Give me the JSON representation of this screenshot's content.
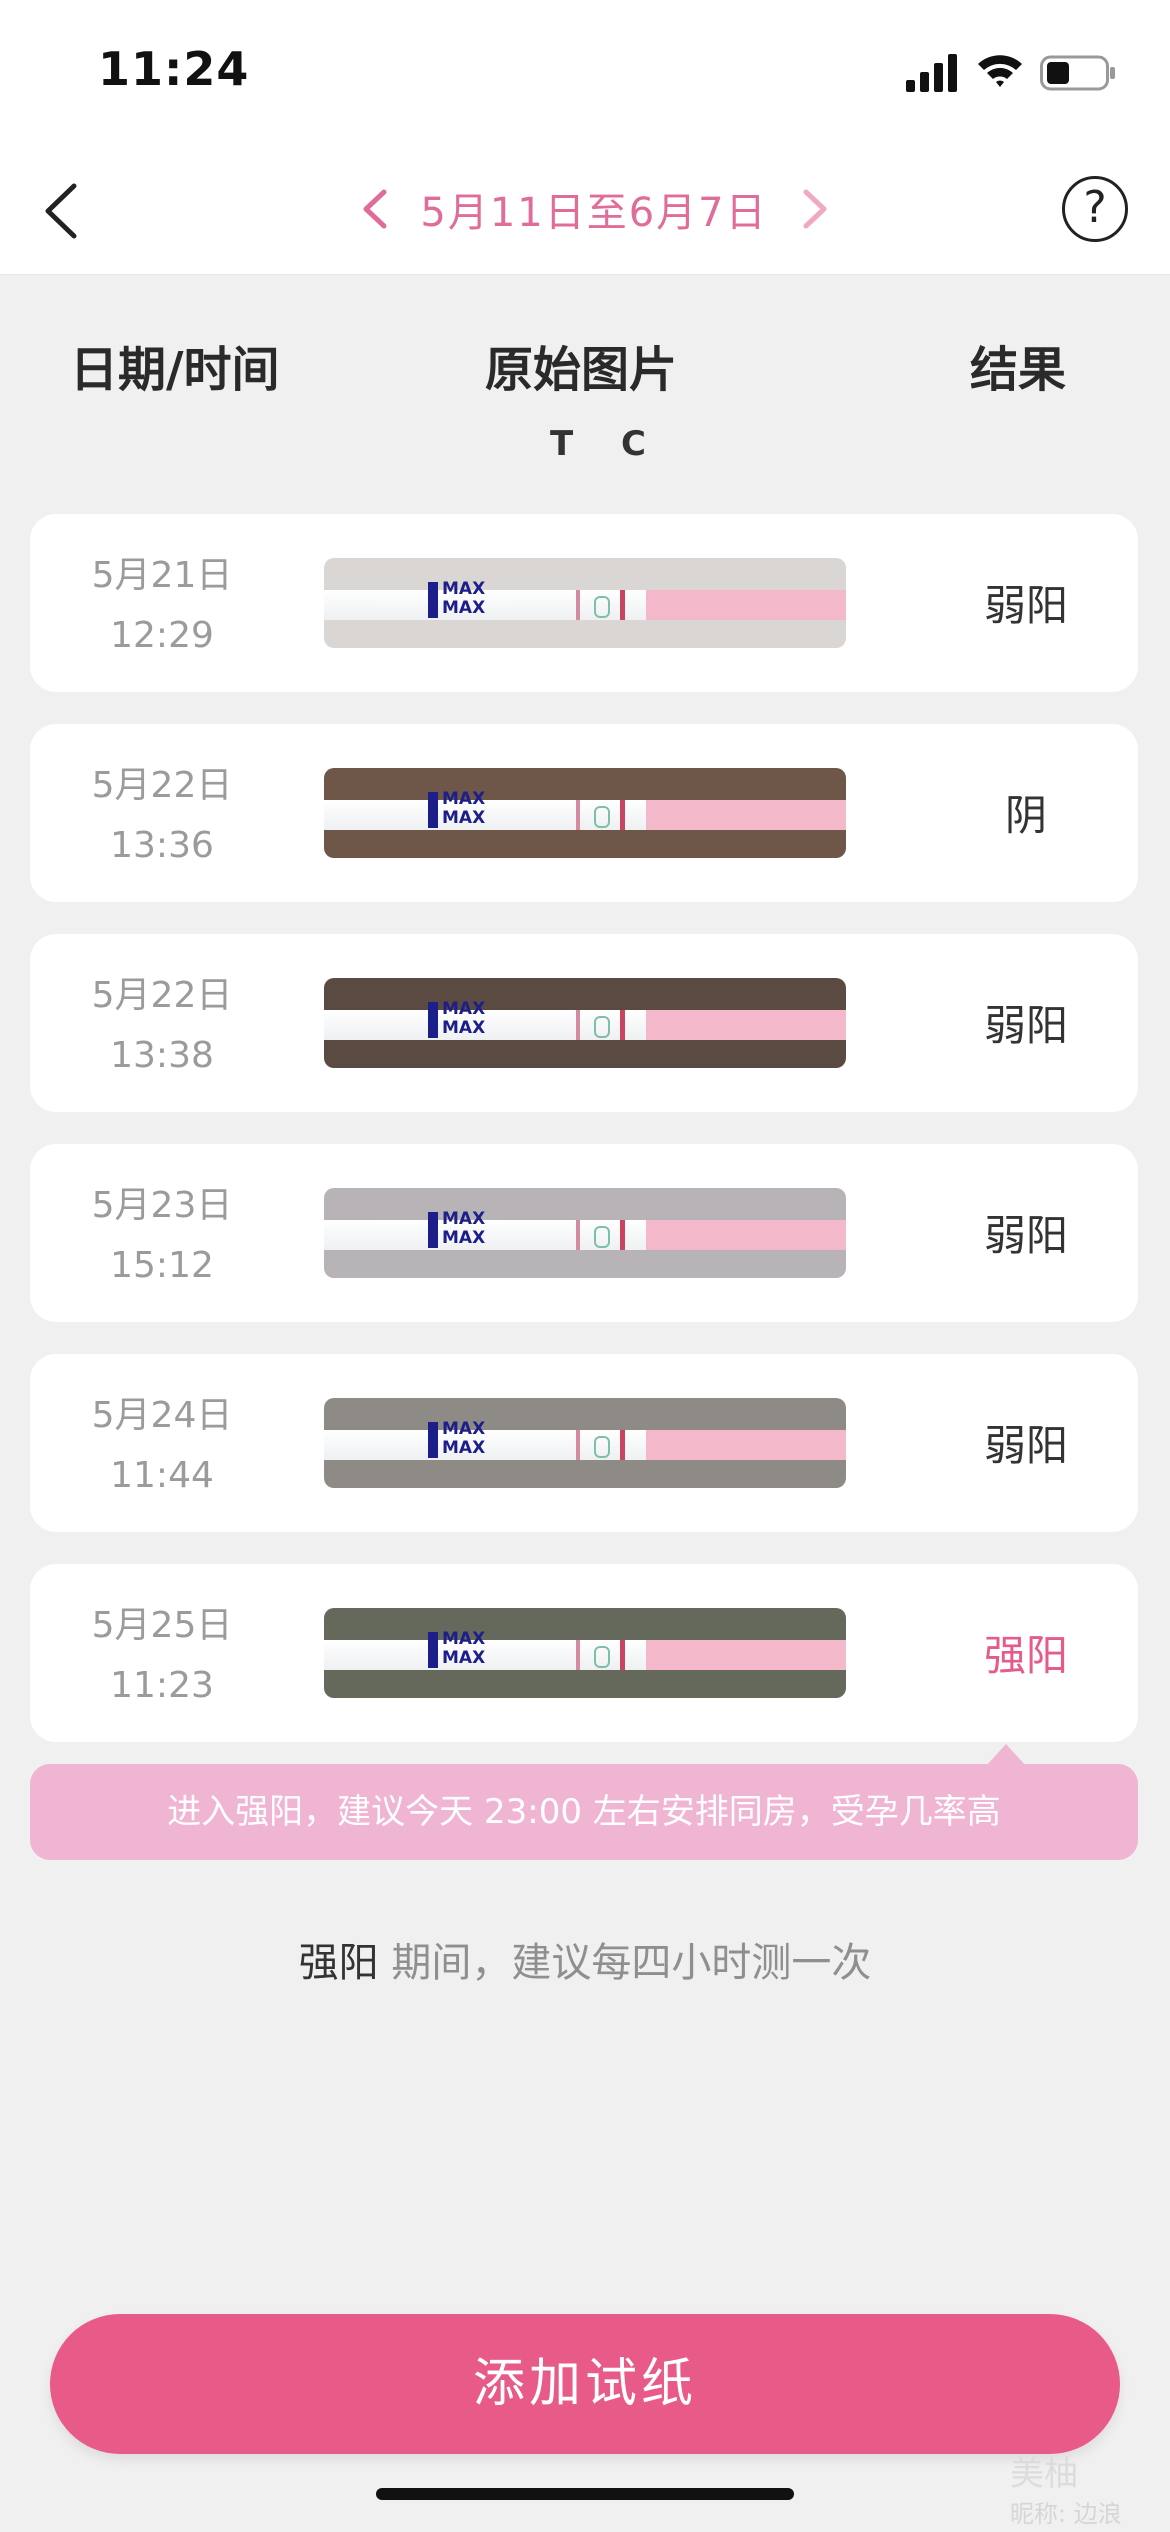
{
  "status": {
    "time": "11:24"
  },
  "nav": {
    "range_title": "5月11日至6月7日",
    "help": "?"
  },
  "columns": {
    "date": "日期/时间",
    "image": "原始图片",
    "result": "结果",
    "tc": "T C"
  },
  "rows": [
    {
      "date": "5月21日",
      "time": "12:29",
      "result": "弱阳",
      "strong": false,
      "bg": "#d9d6d4"
    },
    {
      "date": "5月22日",
      "time": "13:36",
      "result": "阴",
      "strong": false,
      "bg": "#6e5649"
    },
    {
      "date": "5月22日",
      "time": "13:38",
      "result": "弱阳",
      "strong": false,
      "bg": "#5a4a42"
    },
    {
      "date": "5月23日",
      "time": "15:12",
      "result": "弱阳",
      "strong": false,
      "bg": "#b8b3b6"
    },
    {
      "date": "5月24日",
      "time": "11:44",
      "result": "弱阳",
      "strong": false,
      "bg": "#8e8a86"
    },
    {
      "date": "5月25日",
      "time": "11:23",
      "result": "强阳",
      "strong": true,
      "bg": "#64695c"
    }
  ],
  "strip": {
    "max_label": "MAX"
  },
  "tip": "进入强阳，建议今天 23:00 左右安排同房，受孕几率高",
  "advice": {
    "highlight": "强阳",
    "text": " 期间，建议每四小时测一次"
  },
  "add_button": "添加试纸",
  "watermark": {
    "brand": "美柚",
    "nickname": "昵称: 边浪"
  },
  "colors": {
    "accent": "#e85a87",
    "title_pink": "#e06d99",
    "tip_bg": "#f0b5d3"
  }
}
